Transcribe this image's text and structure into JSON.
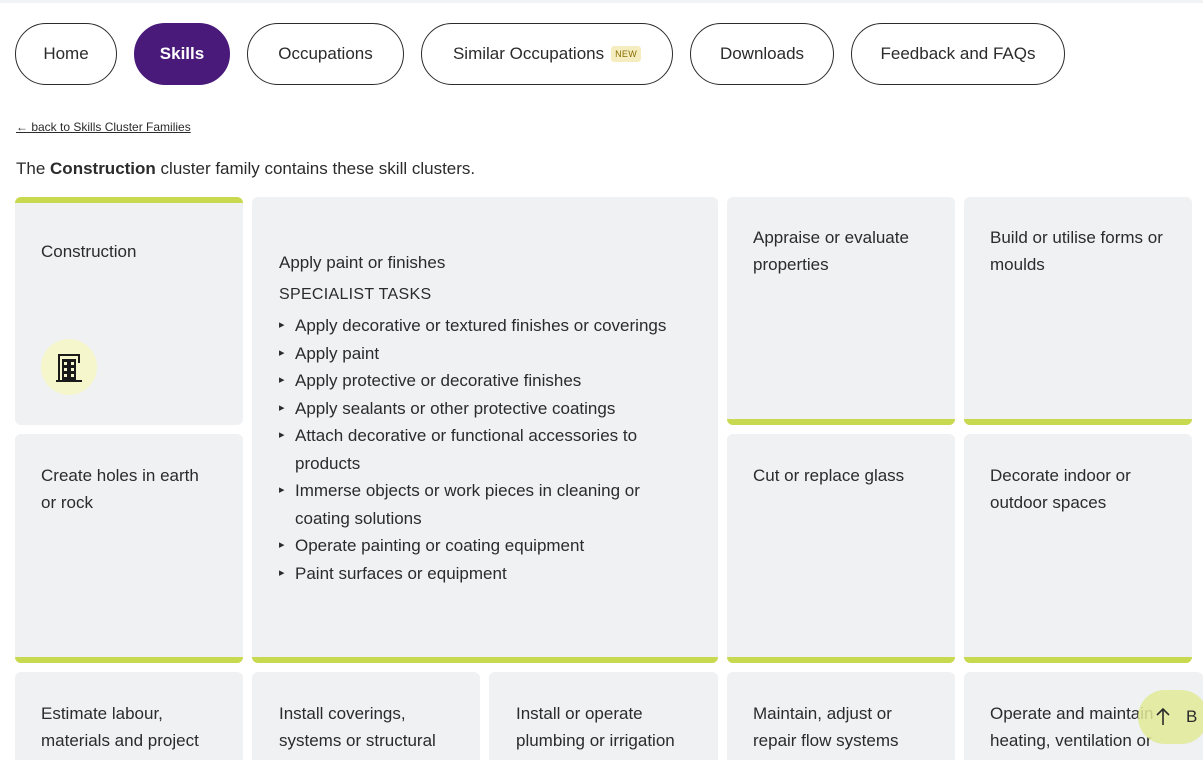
{
  "nav": {
    "items": [
      {
        "label": "Home",
        "active": false
      },
      {
        "label": "Skills",
        "active": true
      },
      {
        "label": "Occupations",
        "active": false
      },
      {
        "label": "Similar Occupations",
        "badge": "NEW",
        "active": false
      },
      {
        "label": "Downloads",
        "active": false
      },
      {
        "label": "Feedback and FAQs",
        "active": false
      }
    ]
  },
  "back_link": "← back to Skills Cluster Families",
  "intro": {
    "prefix": "The ",
    "family": "Construction",
    "suffix": " cluster family contains these skill clusters."
  },
  "family_card": {
    "title": "Construction",
    "icon": "building-construction-icon"
  },
  "expanded_card": {
    "title": "Apply paint or finishes",
    "tasks_heading": "SPECIALIST TASKS",
    "tasks": [
      "Apply decorative or textured finishes or coverings",
      "Apply paint",
      "Apply protective or decorative finishes",
      "Apply sealants or other protective coatings",
      "Attach decorative or functional accessories to products",
      "Immerse objects or work pieces in cleaning or coating solutions",
      "Operate painting or coating equipment",
      "Paint surfaces or equipment"
    ]
  },
  "clusters": [
    "Appraise or evaluate properties",
    "Build or utilise forms or moulds",
    "Create holes in earth or rock",
    "Cut or replace glass",
    "Decorate indoor or outdoor spaces",
    "Estimate labour, materials and project",
    "Install coverings, systems or structural",
    "Install or operate plumbing or irrigation",
    "Maintain, adjust or repair flow systems",
    "Operate and maintain heating, ventilation or"
  ],
  "back_to_top": {
    "icon": "arrow-up-icon",
    "label": "B"
  },
  "colors": {
    "accent": "#c8d84f",
    "nav_active": "#4a1a7a",
    "card_bg": "#f0f1f3",
    "icon_bg": "#f5f6cc"
  }
}
